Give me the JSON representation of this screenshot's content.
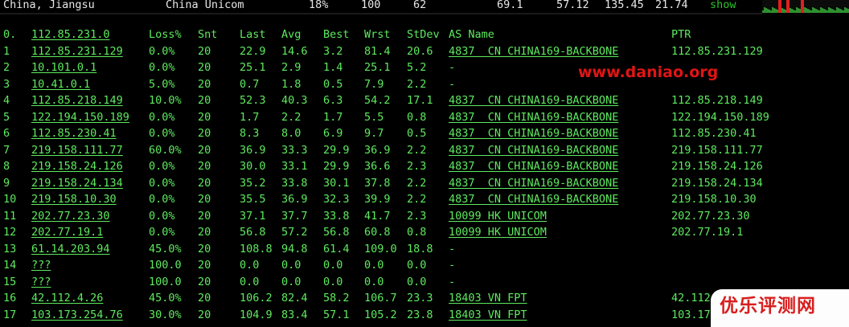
{
  "status_bar": {
    "location": "China, Jiangsu",
    "isp": "China Unicom",
    "loss": "18%",
    "sent": "100",
    "recv": "62",
    "avg": "69.1",
    "best": "57.12",
    "worst": "135.45",
    "stdev": "21.74",
    "show_label": "show"
  },
  "columns": {
    "hop": "0.",
    "host": "112.85.231.0",
    "loss": "Loss%",
    "snt": "Snt",
    "last": "Last",
    "avg": "Avg",
    "best": "Best",
    "wrst": "Wrst",
    "stdev": "StDev",
    "as": "AS Name",
    "ptr": "PTR"
  },
  "hops": [
    {
      "hop": "1",
      "host": "112.85.231.129",
      "loss": "0.0%",
      "snt": "20",
      "last": "22.9",
      "avg": "14.6",
      "best": "3.2",
      "wrst": "81.4",
      "stdev": "20.6",
      "as": "4837  CN CHINA169-BACKBONE",
      "ptr": "112.85.231.129"
    },
    {
      "hop": "2",
      "host": "10.101.0.1",
      "loss": "0.0%",
      "snt": "20",
      "last": "25.1",
      "avg": "2.9",
      "best": "1.4",
      "wrst": "25.1",
      "stdev": "5.2",
      "as": "-",
      "ptr": ""
    },
    {
      "hop": "3",
      "host": "10.41.0.1",
      "loss": "5.0%",
      "snt": "20",
      "last": "0.7",
      "avg": "1.8",
      "best": "0.5",
      "wrst": "7.9",
      "stdev": "2.2",
      "as": "-",
      "ptr": ""
    },
    {
      "hop": "4",
      "host": "112.85.218.149",
      "loss": "10.0%",
      "snt": "20",
      "last": "52.3",
      "avg": "40.3",
      "best": "6.3",
      "wrst": "54.2",
      "stdev": "17.1",
      "as": "4837  CN CHINA169-BACKBONE",
      "ptr": "112.85.218.149"
    },
    {
      "hop": "5",
      "host": "122.194.150.189",
      "loss": "0.0%",
      "snt": "20",
      "last": "1.7",
      "avg": "2.2",
      "best": "1.7",
      "wrst": "5.5",
      "stdev": "0.8",
      "as": "4837  CN CHINA169-BACKBONE",
      "ptr": "122.194.150.189"
    },
    {
      "hop": "6",
      "host": "112.85.230.41",
      "loss": "0.0%",
      "snt": "20",
      "last": "8.3",
      "avg": "8.0",
      "best": "6.9",
      "wrst": "9.7",
      "stdev": "0.5",
      "as": "4837  CN CHINA169-BACKBONE",
      "ptr": "112.85.230.41"
    },
    {
      "hop": "7",
      "host": "219.158.111.77",
      "loss": "60.0%",
      "snt": "20",
      "last": "36.9",
      "avg": "33.3",
      "best": "29.9",
      "wrst": "36.9",
      "stdev": "2.2",
      "as": "4837  CN CHINA169-BACKBONE",
      "ptr": "219.158.111.77"
    },
    {
      "hop": "8",
      "host": "219.158.24.126",
      "loss": "0.0%",
      "snt": "20",
      "last": "30.0",
      "avg": "33.1",
      "best": "29.9",
      "wrst": "36.6",
      "stdev": "2.3",
      "as": "4837  CN CHINA169-BACKBONE",
      "ptr": "219.158.24.126"
    },
    {
      "hop": "9",
      "host": "219.158.24.134",
      "loss": "0.0%",
      "snt": "20",
      "last": "35.2",
      "avg": "33.8",
      "best": "30.1",
      "wrst": "37.8",
      "stdev": "2.2",
      "as": "4837  CN CHINA169-BACKBONE",
      "ptr": "219.158.24.134"
    },
    {
      "hop": "10",
      "host": "219.158.10.30",
      "loss": "0.0%",
      "snt": "20",
      "last": "35.5",
      "avg": "36.9",
      "best": "32.3",
      "wrst": "39.9",
      "stdev": "2.2",
      "as": "4837  CN CHINA169-BACKBONE",
      "ptr": "219.158.10.30"
    },
    {
      "hop": "11",
      "host": "202.77.23.30",
      "loss": "0.0%",
      "snt": "20",
      "last": "37.1",
      "avg": "37.7",
      "best": "33.8",
      "wrst": "41.7",
      "stdev": "2.3",
      "as": "10099 HK UNICOM",
      "ptr": "202.77.23.30"
    },
    {
      "hop": "12",
      "host": "202.77.19.1",
      "loss": "0.0%",
      "snt": "20",
      "last": "56.8",
      "avg": "57.2",
      "best": "56.8",
      "wrst": "60.8",
      "stdev": "0.8",
      "as": "10099 HK UNICOM",
      "ptr": "202.77.19.1"
    },
    {
      "hop": "13",
      "host": "61.14.203.94",
      "loss": "45.0%",
      "snt": "20",
      "last": "108.8",
      "avg": "94.8",
      "best": "61.4",
      "wrst": "109.0",
      "stdev": "18.8",
      "as": "-",
      "ptr": ""
    },
    {
      "hop": "14",
      "host": "???",
      "loss": "100.0",
      "snt": "20",
      "last": "0.0",
      "avg": "0.0",
      "best": "0.0",
      "wrst": "0.0",
      "stdev": "0.0",
      "as": "-",
      "ptr": ""
    },
    {
      "hop": "15",
      "host": "???",
      "loss": "100.0",
      "snt": "20",
      "last": "0.0",
      "avg": "0.0",
      "best": "0.0",
      "wrst": "0.0",
      "stdev": "0.0",
      "as": "-",
      "ptr": ""
    },
    {
      "hop": "16",
      "host": "42.112.4.26",
      "loss": "45.0%",
      "snt": "20",
      "last": "106.2",
      "avg": "82.4",
      "best": "58.2",
      "wrst": "106.7",
      "stdev": "23.3",
      "as": "18403 VN FPT",
      "ptr": "42.112"
    },
    {
      "hop": "17",
      "host": "103.173.254.76",
      "loss": "30.0%",
      "snt": "20",
      "last": "104.9",
      "avg": "83.4",
      "best": "57.1",
      "wrst": "105.2",
      "stdev": "23.8",
      "as": "18403 VN FPT",
      "ptr": "103.17"
    }
  ],
  "watermark": "www.daniao.org",
  "logo_text": "优乐评测网",
  "colors": {
    "background": "#000000",
    "terminal_green": "#5eea5e",
    "show_green": "#27c427",
    "watermark_red": "#e01515",
    "spark_red": "#e02020",
    "spark_green": "#2f8f2f"
  }
}
